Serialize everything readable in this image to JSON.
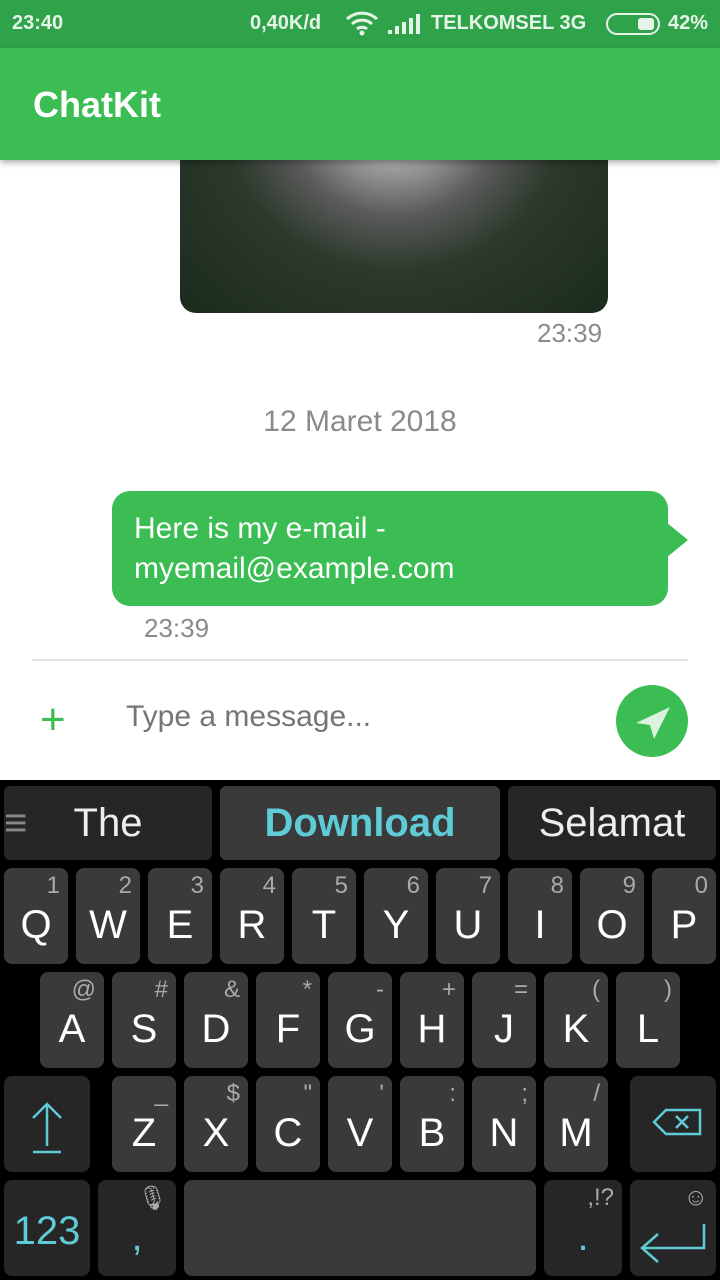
{
  "status": {
    "time": "23:40",
    "speed": "0,40K/d",
    "carrier": "TELKOMSEL 3G",
    "battery": "42%"
  },
  "app": {
    "title": "ChatKit"
  },
  "messages": {
    "image_time": "23:39",
    "date": "12 Maret 2018",
    "text": "Here is my e-mail - myemail@example.com",
    "text_time": "23:39"
  },
  "composer": {
    "placeholder": "Type a message..."
  },
  "colors": {
    "accent": "#3bbd54",
    "keyboard_accent": "#5fcbd6"
  },
  "keyboard": {
    "suggestions": [
      "The",
      "Download",
      "Selamat"
    ],
    "row1": [
      [
        "Q",
        "1"
      ],
      [
        "W",
        "2"
      ],
      [
        "E",
        "3"
      ],
      [
        "R",
        "4"
      ],
      [
        "T",
        "5"
      ],
      [
        "Y",
        "6"
      ],
      [
        "U",
        "7"
      ],
      [
        "I",
        "8"
      ],
      [
        "O",
        "9"
      ],
      [
        "P",
        "0"
      ]
    ],
    "row2": [
      [
        "A",
        "@"
      ],
      [
        "S",
        "#"
      ],
      [
        "D",
        "&"
      ],
      [
        "F",
        "*"
      ],
      [
        "G",
        "-"
      ],
      [
        "H",
        "+"
      ],
      [
        "J",
        "="
      ],
      [
        "K",
        "("
      ],
      [
        "L",
        ")"
      ]
    ],
    "row3": [
      [
        "Z",
        "_"
      ],
      [
        "X",
        "$"
      ],
      [
        "C",
        "\""
      ],
      [
        "V",
        "'"
      ],
      [
        "B",
        ":"
      ],
      [
        "N",
        ";"
      ],
      [
        "M",
        "/"
      ]
    ],
    "numbers": "123",
    "comma": ",",
    "period": ".",
    "period_hint": ",!?"
  }
}
